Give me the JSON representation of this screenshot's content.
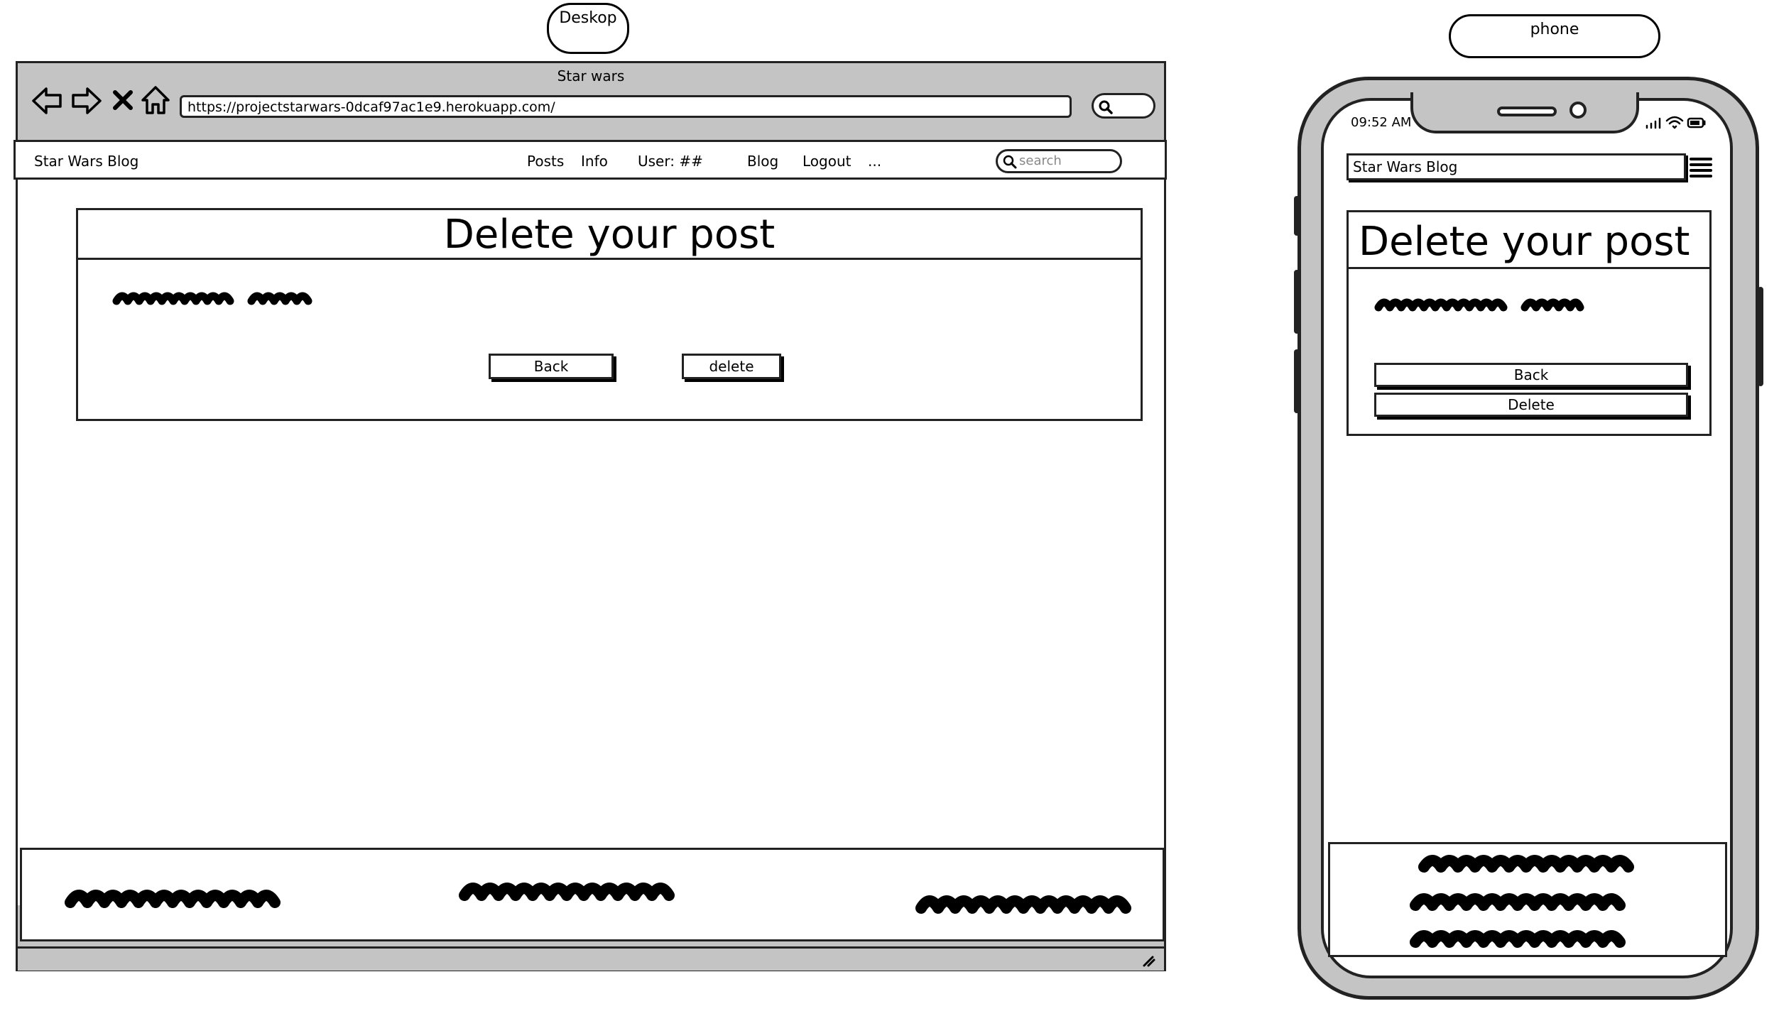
{
  "labels": {
    "desktop": "Deskop",
    "phone": "phone"
  },
  "desktop": {
    "window_title": "Star wars",
    "url": "https://projectstarwars-0dcaf97ac1e9.herokuapp.com/",
    "nav": {
      "brand": "Star Wars Blog",
      "posts": "Posts",
      "info": "Info",
      "user": "User: ##",
      "blog": "Blog",
      "logout": "Logout",
      "more": "...",
      "search_placeholder": "search"
    },
    "card": {
      "title": "Delete your post",
      "back": "Back",
      "delete": "delete"
    }
  },
  "phone": {
    "time": "09:52 AM",
    "brand": "Star Wars Blog",
    "card": {
      "title": "Delete your post",
      "back": "Back",
      "delete": "Delete"
    }
  }
}
